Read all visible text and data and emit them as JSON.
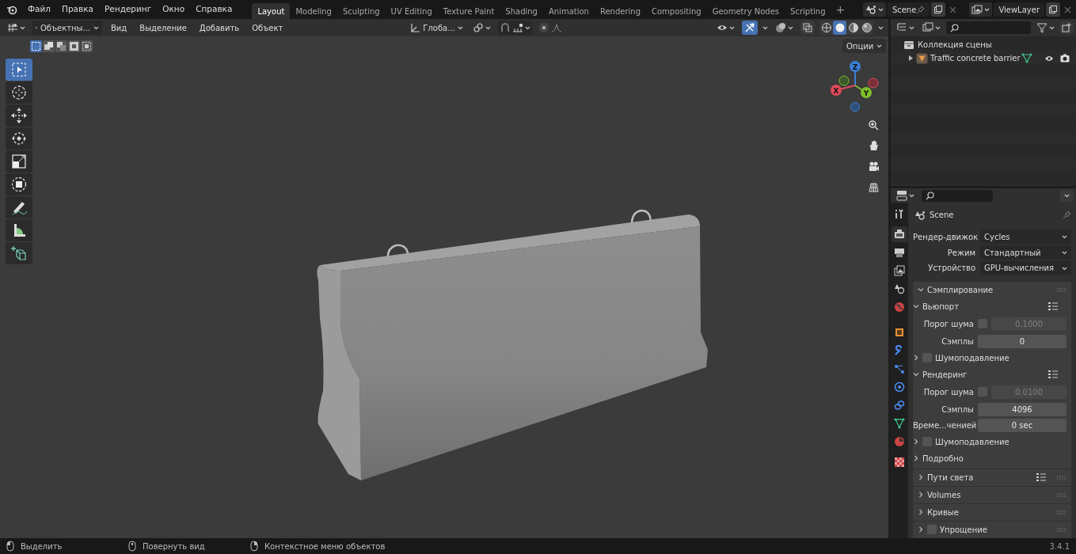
{
  "menu": [
    "Файл",
    "Правка",
    "Рендеринг",
    "Окно",
    "Справка"
  ],
  "workspaces": [
    {
      "label": "Layout",
      "selected": true
    },
    {
      "label": "Modeling",
      "selected": false
    },
    {
      "label": "Sculpting",
      "selected": false
    },
    {
      "label": "UV Editing",
      "selected": false
    },
    {
      "label": "Texture Paint",
      "selected": false
    },
    {
      "label": "Shading",
      "selected": false
    },
    {
      "label": "Animation",
      "selected": false
    },
    {
      "label": "Rendering",
      "selected": false
    },
    {
      "label": "Compositing",
      "selected": false
    },
    {
      "label": "Geometry Nodes",
      "selected": false
    },
    {
      "label": "Scripting",
      "selected": false
    }
  ],
  "add_workspace": "+",
  "scene": "Scene",
  "view_layer": "ViewLayer",
  "viewport": {
    "mode": "Объектны...",
    "menus": [
      "Вид",
      "Выделение",
      "Добавить",
      "Объект"
    ],
    "orientation": "Глоба...",
    "options": "Опции",
    "show_gizmo": true,
    "shading": [
      {
        "selected": false
      },
      {
        "selected": true
      },
      {
        "selected": false
      },
      {
        "selected": false
      }
    ],
    "select_modes": [
      {
        "selected": true
      },
      {
        "selected": false
      },
      {
        "selected": false
      },
      {
        "selected": false
      },
      {
        "selected": false
      }
    ],
    "tools": [
      {
        "kind": "select",
        "selected": true
      },
      {
        "kind": "cursor",
        "selected": false
      },
      {
        "kind": "move",
        "selected": false
      },
      {
        "kind": "rotate",
        "selected": false
      },
      {
        "kind": "scale",
        "selected": false
      },
      {
        "kind": "transform",
        "selected": false
      },
      {
        "kind": "annotate",
        "selected": false
      },
      {
        "kind": "measure",
        "selected": false
      },
      {
        "kind": "add-cube",
        "selected": false
      }
    ],
    "gizmo": {
      "x": "X",
      "y": "Y",
      "z": "Z"
    }
  },
  "outliner": {
    "collection": "Коллекция сцены",
    "items": [
      {
        "name": "Traffic concrete barrier",
        "expanded": false
      }
    ]
  },
  "properties": {
    "context": "Scene",
    "tabs": [
      {
        "kind": "tool",
        "selected": false
      },
      {
        "kind": "render",
        "selected": true
      },
      {
        "kind": "output",
        "selected": false
      },
      {
        "kind": "view-layer",
        "selected": false
      },
      {
        "kind": "scene",
        "selected": false
      },
      {
        "kind": "world",
        "selected": false
      },
      {
        "kind": "object",
        "selected": false
      },
      {
        "kind": "modifier",
        "selected": false
      },
      {
        "kind": "particles",
        "selected": false
      },
      {
        "kind": "physics",
        "selected": false
      },
      {
        "kind": "constraints",
        "selected": false
      },
      {
        "kind": "data",
        "selected": false
      },
      {
        "kind": "material",
        "selected": false
      },
      {
        "kind": "texture",
        "selected": false
      }
    ],
    "fields": [
      {
        "label": "Рендер-движок",
        "value": "Cycles"
      },
      {
        "label": "Режим",
        "value": "Стандартный"
      },
      {
        "label": "Устройство",
        "value": "GPU-вычисления"
      }
    ],
    "panels": [
      {
        "title": "Сэмплирование",
        "expanded": true,
        "children": [
          {
            "title": "Вьюпорт",
            "expanded": true,
            "presets": true,
            "rows": [
              {
                "kind": "checkbox-number",
                "label": "Порог шума",
                "checked": false,
                "value": "0.1000"
              },
              {
                "kind": "number",
                "label": "Сэмплы",
                "value": "0"
              }
            ],
            "children": [
              {
                "title": "Шумоподавление",
                "expanded": false,
                "checked": false
              }
            ]
          },
          {
            "title": "Рендеринг",
            "expanded": true,
            "presets": true,
            "rows": [
              {
                "kind": "checkbox-number",
                "label": "Порог шума",
                "checked": false,
                "value": "0.0100"
              },
              {
                "kind": "number",
                "label": "Сэмплы",
                "value": "4096"
              },
              {
                "kind": "number",
                "label": "Време...ченией",
                "value": "0 sec"
              }
            ],
            "children": [
              {
                "title": "Шумоподавление",
                "expanded": false,
                "checked": false
              }
            ]
          },
          {
            "title": "Подробно",
            "expanded": false
          }
        ]
      },
      {
        "title": "Пути света",
        "expanded": false,
        "presets": true
      },
      {
        "title": "Volumes",
        "expanded": false
      },
      {
        "title": "Кривые",
        "expanded": false
      },
      {
        "title": "Упрощение",
        "expanded": false,
        "checked": false
      }
    ]
  },
  "status_bar": {
    "hints": [
      "Выделить",
      "Повернуть вид",
      "Контекстное меню объектов"
    ],
    "version": "3.4.1"
  }
}
